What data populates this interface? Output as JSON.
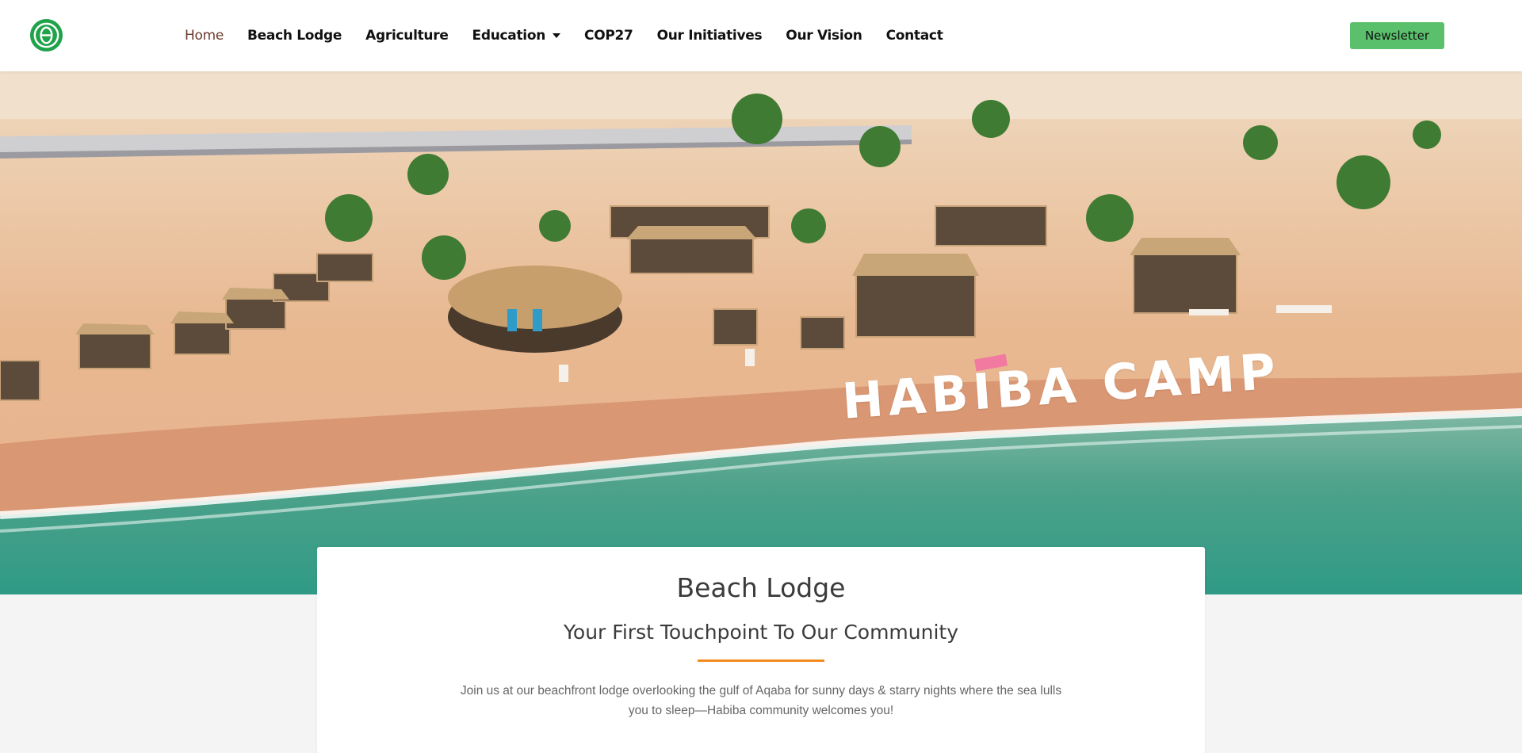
{
  "nav": {
    "items": [
      {
        "label": "Home"
      },
      {
        "label": "Beach Lodge"
      },
      {
        "label": "Agriculture"
      },
      {
        "label": "Education"
      },
      {
        "label": "COP27"
      },
      {
        "label": "Our Initiatives"
      },
      {
        "label": "Our Vision"
      },
      {
        "label": "Contact"
      }
    ],
    "newsletter_label": "Newsletter"
  },
  "hero": {
    "caption": "HABIBA CAMP"
  },
  "content": {
    "title": "Beach Lodge",
    "subtitle": "Your First Touchpoint To Our Community",
    "body": "Join us at our beachfront lodge overlooking the gulf of Aqaba for sunny days & starry nights where the sea lulls you to sleep—Habiba community welcomes you!"
  },
  "colors": {
    "brand_green": "#1fa34a",
    "button_green": "#5ac06b",
    "active_link": "#6b3a2e",
    "divider_orange": "#f28b1e"
  }
}
